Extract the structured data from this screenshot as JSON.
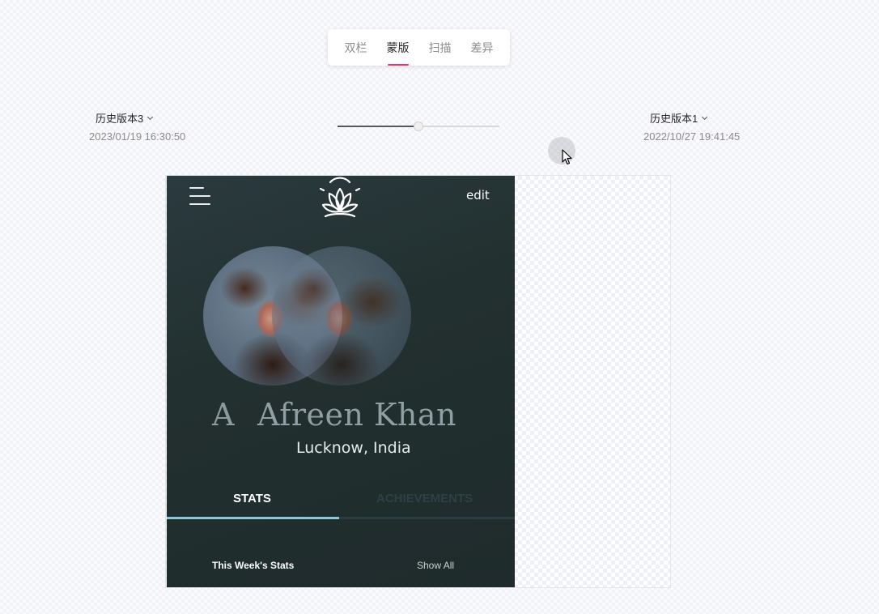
{
  "mode_tabs": [
    {
      "label": "双栏",
      "active": false
    },
    {
      "label": "蒙版",
      "active": true
    },
    {
      "label": "扫描",
      "active": false
    },
    {
      "label": "差异",
      "active": false
    }
  ],
  "left_version": {
    "name": "历史版本3",
    "time": "2023/01/19 16:30:50"
  },
  "right_version": {
    "name": "历史版本1",
    "time": "2022/10/27 19:41:45"
  },
  "slider": {
    "value": 0.5
  },
  "colors": {
    "accent": "#e8356b",
    "screen_bg": "#22302f",
    "tab_active": "#8ec6d6"
  },
  "screen": {
    "edit_label": "edit",
    "name_ghost": "A",
    "name": "Afreen Khan",
    "location": "Lucknow, India",
    "tabs": [
      {
        "label": "STATS",
        "active": true
      },
      {
        "label": "ACHIEVEMENTS",
        "active": false
      }
    ],
    "week_title": "This Week's Stats",
    "show_all": "Show All"
  }
}
